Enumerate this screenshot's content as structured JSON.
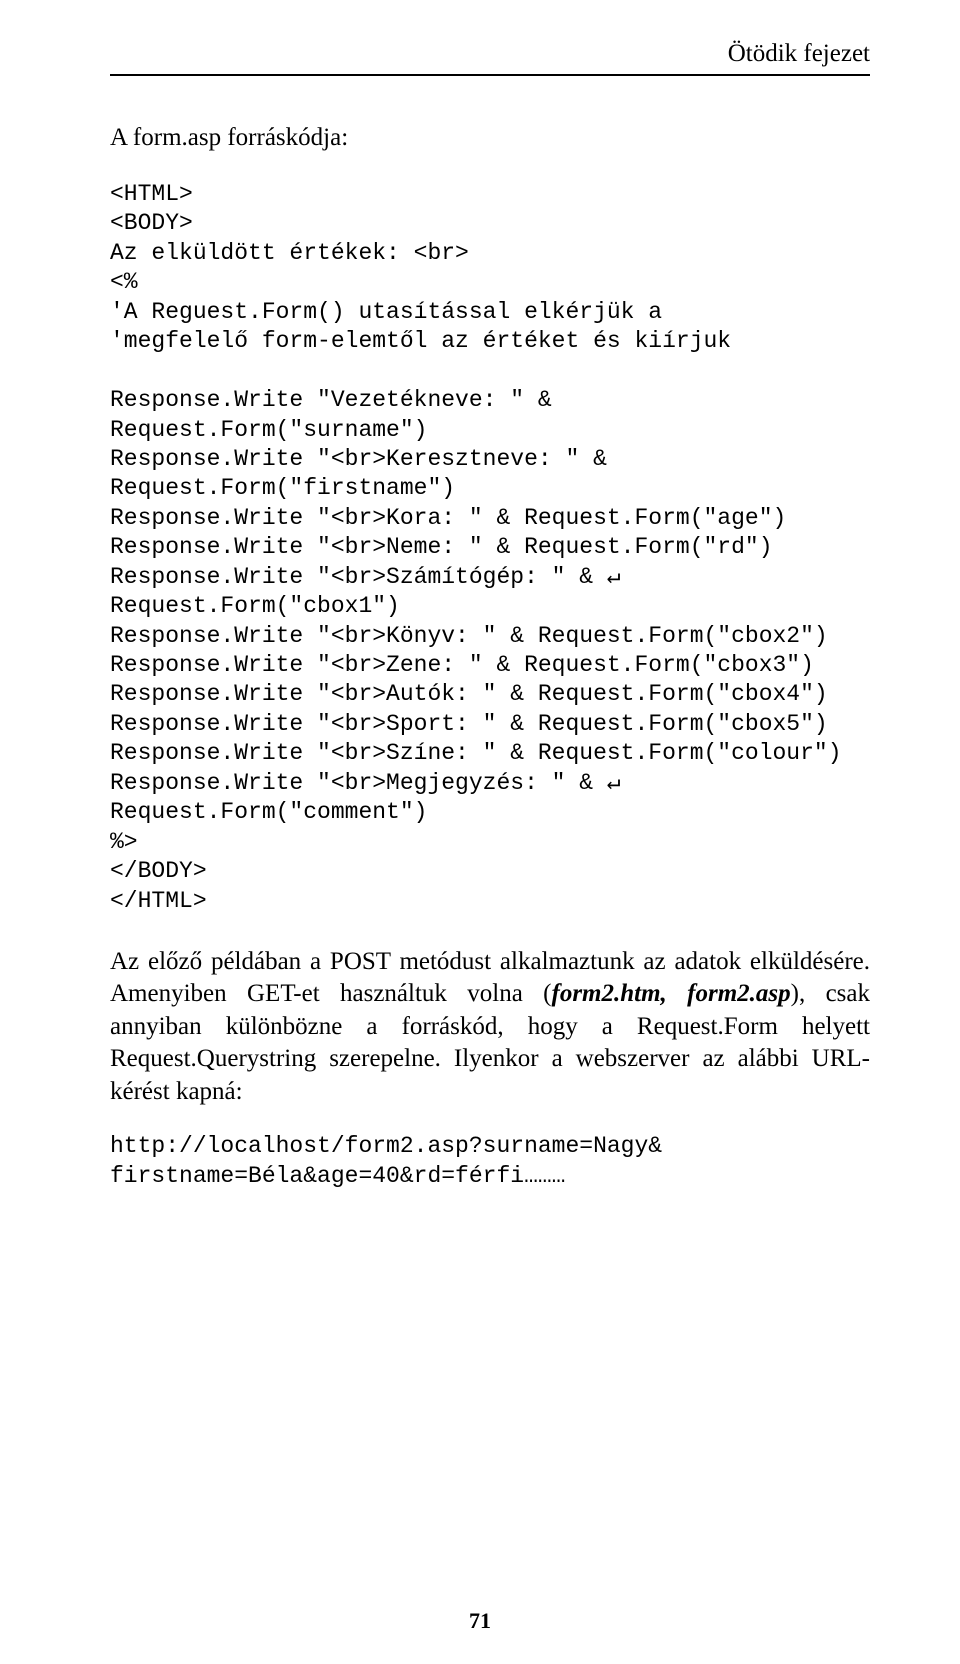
{
  "header": {
    "chapter": "Ötödik fejezet"
  },
  "title": "A form.asp forráskódja:",
  "code": "<HTML>\n<BODY>\nAz elküldött értékek: <br>\n<%\n'A Reguest.Form() utasítással elkérjük a\n'megfelelő form-elemtől az értéket és kiírjuk\n\nResponse.Write \"Vezetékneve: \" &\nRequest.Form(\"surname\")\nResponse.Write \"<br>Keresztneve: \" &\nRequest.Form(\"firstname\")\nResponse.Write \"<br>Kora: \" & Request.Form(\"age\")\nResponse.Write \"<br>Neme: \" & Request.Form(\"rd\")\nResponse.Write \"<br>Számítógép: \" & ↵\nRequest.Form(\"cbox1\")\nResponse.Write \"<br>Könyv: \" & Request.Form(\"cbox2\")\nResponse.Write \"<br>Zene: \" & Request.Form(\"cbox3\")\nResponse.Write \"<br>Autók: \" & Request.Form(\"cbox4\")\nResponse.Write \"<br>Sport: \" & Request.Form(\"cbox5\")\nResponse.Write \"<br>Színe: \" & Request.Form(\"colour\")\nResponse.Write \"<br>Megjegyzés: \" & ↵\nRequest.Form(\"comment\")\n%>\n</BODY>\n</HTML>",
  "para": {
    "p1a": "Az előző példában a POST metódust alkalmaztunk az adatok elküldésére. Amenyiben GET-et használtuk volna (",
    "p1b": "form2.htm, form2.asp",
    "p1c": "), csak annyiban különbözne a forráskód, hogy a Request.Form helyett Request.Querystring szerepelne.  Ilyenkor a webszerver az alábbi URL-kérést kapná:"
  },
  "url": "http://localhost/form2.asp?surname=Nagy&\nfirstname=Béla&age=40&rd=férfi………",
  "page_number": "71"
}
